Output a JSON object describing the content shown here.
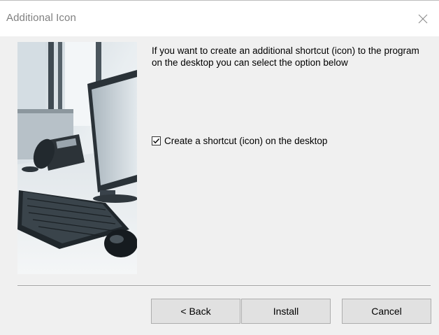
{
  "window": {
    "title": "Additional Icon"
  },
  "main": {
    "intro_text": "If you want to create an additional shortcut (icon) to the program on the desktop you can select the option below",
    "checkbox": {
      "label": "Create a shortcut (icon) on the desktop",
      "checked": true
    }
  },
  "buttons": {
    "back": "< Back",
    "install": "Install",
    "cancel": "Cancel"
  },
  "icons": {
    "close": "close-icon",
    "checkmark": "checkmark-icon"
  },
  "colors": {
    "window_bg": "#f0f0f0",
    "title_text": "#808080",
    "button_bg": "#e1e1e1",
    "button_border": "#adadad"
  }
}
